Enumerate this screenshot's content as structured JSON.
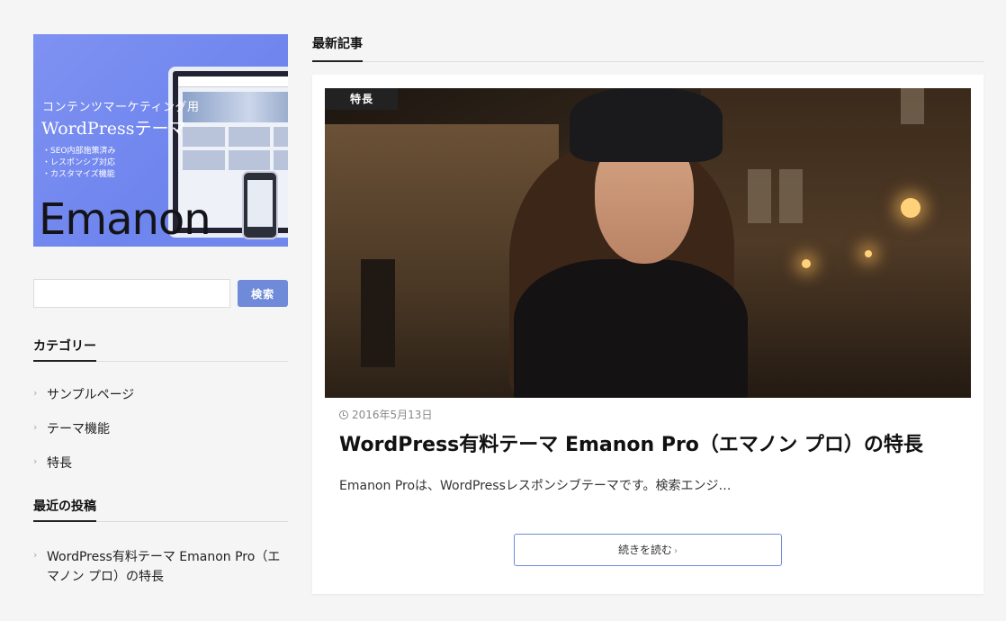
{
  "sidebar": {
    "banner": {
      "subtitle": "コンテンツマーケティング用",
      "headline": "WordPressテーマ",
      "bullets": [
        "・SEO内部施策済み",
        "・レスポンシブ対応",
        "・カスタマイズ機能"
      ],
      "logo": "Emanon"
    },
    "search": {
      "value": "",
      "button_label": "検索"
    },
    "categories": {
      "heading": "カテゴリー",
      "items": [
        "サンプルページ",
        "テーマ機能",
        "特長"
      ]
    },
    "recent_posts": {
      "heading": "最近の投稿",
      "items": [
        "WordPress有料テーマ Emanon Pro（エマノン プロ）の特長"
      ]
    }
  },
  "main": {
    "section_heading": "最新記事",
    "post": {
      "category_tag": "特長",
      "date": "2016年5月13日",
      "title": "WordPress有料テーマ Emanon Pro（エマノン プロ）の特長",
      "excerpt": "Emanon Proは、WordPressレスポンシブテーマです。検索エンジ…",
      "read_more_label": "続きを読む"
    }
  },
  "colors": {
    "accent": "#6f8ad9",
    "background": "#f5f5f5",
    "tag_bg": "#222222"
  }
}
